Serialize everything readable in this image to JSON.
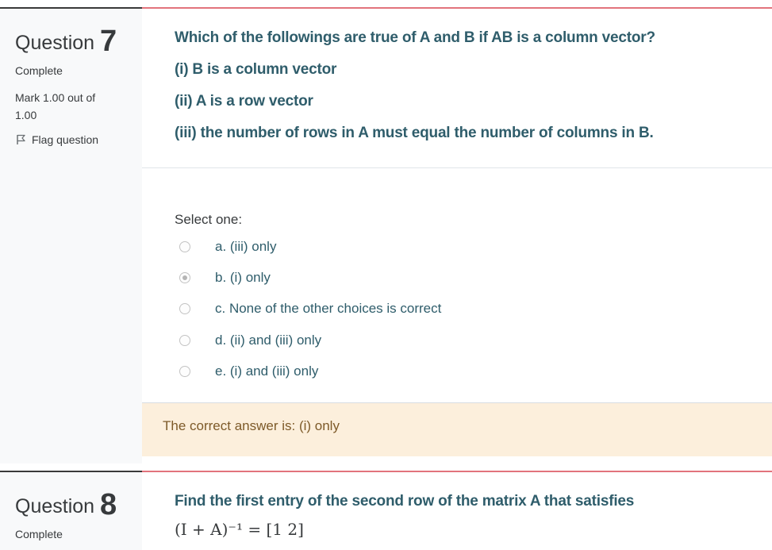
{
  "questions": [
    {
      "label": "Question",
      "number": "7",
      "state": "Complete",
      "mark": "Mark 1.00 out of 1.00",
      "flag_label": "Flag question",
      "text": [
        "Which of the followings are true of A and B if AB is a column vector?",
        "(i) B is a column vector",
        "(ii) A is a row vector",
        "(iii) the number of rows in A must equal the number of columns in B."
      ],
      "prompt": "Select one:",
      "options": [
        {
          "label": "a. (iii) only",
          "selected": false
        },
        {
          "label": "b. (i) only",
          "selected": true
        },
        {
          "label": "c. None of the other choices is correct",
          "selected": false
        },
        {
          "label": "d. (ii) and (iii) only",
          "selected": false
        },
        {
          "label": "e. (i) and (iii) only",
          "selected": false
        }
      ],
      "feedback": "The correct answer is: (i) only"
    },
    {
      "label": "Question",
      "number": "8",
      "state": "Complete",
      "text": [
        "Find the first entry of the second row of the matrix A that satisfies"
      ],
      "formula": "(I + A)⁻¹ = [1  2]"
    }
  ],
  "colors": {
    "question_text": "#2f5d6b",
    "content_border": "#e2737c",
    "feedback_bg": "#fcefdc",
    "feedback_text": "#7d5a29",
    "info_bg": "#f8f9fa"
  },
  "icons": {
    "flag": "flag-icon",
    "radio": "radio-button"
  }
}
